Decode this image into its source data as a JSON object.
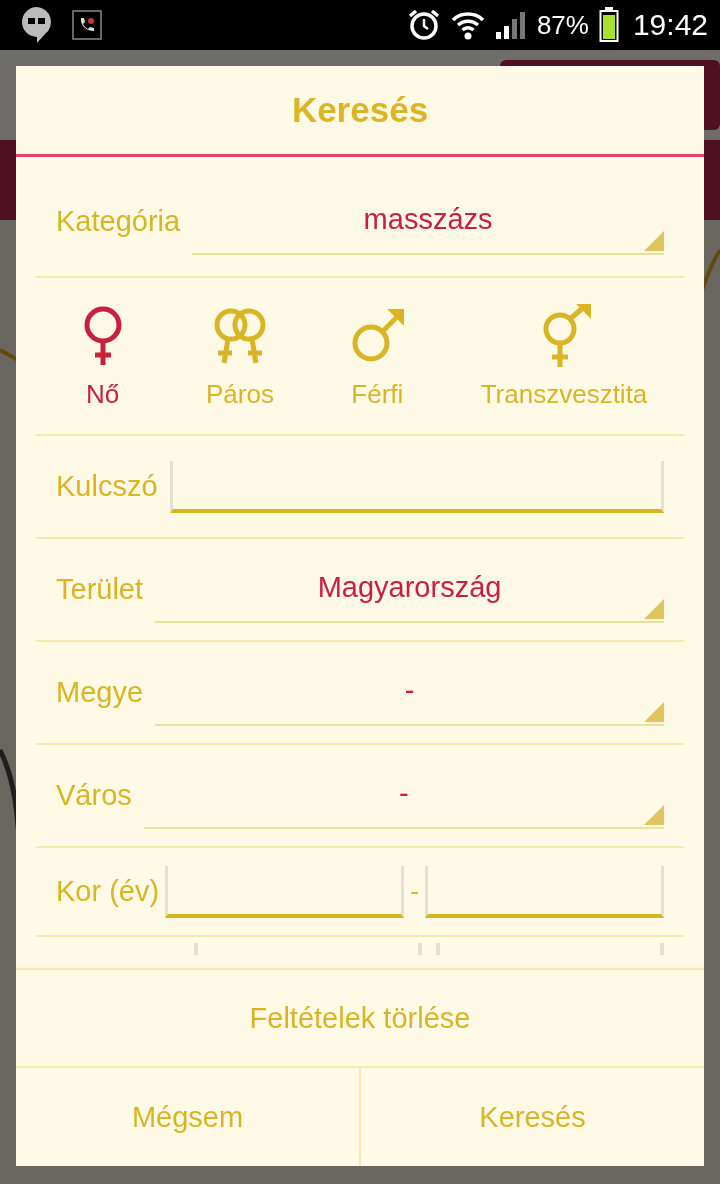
{
  "status_bar": {
    "battery": "87%",
    "time": "19:42"
  },
  "dialog": {
    "title": "Keresés",
    "category": {
      "label": "Kategória",
      "value": "masszázs"
    },
    "genders": [
      {
        "kind": "female",
        "label": "Nő",
        "selected": true
      },
      {
        "kind": "couple",
        "label": "Páros",
        "selected": false
      },
      {
        "kind": "male",
        "label": "Férfi",
        "selected": false
      },
      {
        "kind": "trans",
        "label": "Transzvesztita",
        "selected": false
      }
    ],
    "keyword": {
      "label": "Kulcszó"
    },
    "selects": [
      {
        "label": "Terület",
        "value": "Magyarország"
      },
      {
        "label": "Megye",
        "value": "-"
      },
      {
        "label": "Város",
        "value": "-"
      }
    ],
    "age": {
      "label": "Kor (év)",
      "separator": "-"
    },
    "clear_button": "Feltételek törlése",
    "buttons": [
      "Mégsem",
      "Keresés"
    ]
  }
}
